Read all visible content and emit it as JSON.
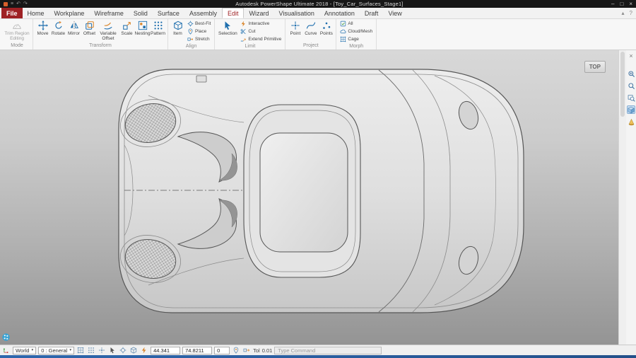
{
  "window": {
    "title": "Autodesk PowerShape Ultimate 2018 - [Toy_Car_Surfaces_Stage1]",
    "minimize_glyph": "–",
    "maximize_glyph": "□",
    "close_glyph": "×"
  },
  "qat": {
    "menu": "≡",
    "undo": "↶",
    "redo": "↷"
  },
  "tabs": {
    "labels": [
      "File",
      "Home",
      "Workplane",
      "Wireframe",
      "Solid",
      "Surface",
      "Assembly",
      "Edit",
      "Wizard",
      "Visualisation",
      "Annotation",
      "Draft",
      "View"
    ],
    "active": "Edit",
    "collapse_glyph": "▴",
    "help_glyph": "?"
  },
  "ribbon": {
    "mode": {
      "group_label": "Mode",
      "trim_label": "Trim Region Editing"
    },
    "transform": {
      "group_label": "Transform",
      "buttons": [
        "Move",
        "Rotate",
        "Mirror",
        "Offset",
        "Variable Offset",
        "Scale",
        "Nesting",
        "Pattern"
      ]
    },
    "align": {
      "group_label": "Align",
      "item_label": "Item",
      "rows": [
        "Best-Fit",
        "Place",
        "Stretch"
      ]
    },
    "limit": {
      "group_label": "Limit",
      "selection_label": "Selection",
      "rows": [
        "Interactive",
        "Cut",
        "Extend Primitive"
      ]
    },
    "project": {
      "group_label": "Project",
      "buttons": [
        "Point",
        "Curve",
        "Points"
      ]
    },
    "morph": {
      "group_label": "Morph",
      "rows": [
        "All",
        "Cloud/Mesh",
        "Cage"
      ]
    }
  },
  "viewport": {
    "view_button_label": "TOP",
    "toolbar_close_glyph": "×"
  },
  "statusbar": {
    "workplane": "World",
    "level": "0 : General",
    "caret": "▾",
    "x": "44.341",
    "y": "74.8211",
    "z": "0",
    "tol_label": "Tol",
    "tol_value": "0.01",
    "command_placeholder": "Type Command"
  },
  "colors": {
    "accent_red": "#9e2124",
    "icon_blue": "#1f6fae",
    "taskbar_blue": "#2e67ad"
  }
}
